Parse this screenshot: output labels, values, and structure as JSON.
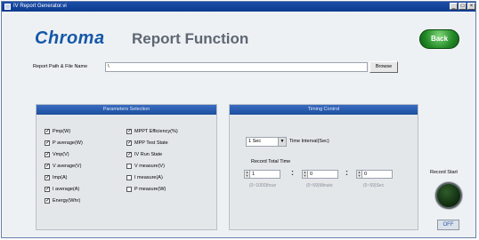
{
  "window": {
    "title": "IV Report Generator.vi",
    "controls": {
      "minimize": "_",
      "maximize": "□",
      "close": "×"
    }
  },
  "header": {
    "logo": "Chroma",
    "title": "Report Function",
    "back_label": "Back"
  },
  "report_path": {
    "label": "Report Path & File Name",
    "value": "\\",
    "browse_label": "Browse"
  },
  "parameters": {
    "title": "Parameters Selection",
    "left_column": [
      {
        "label": "Pmp(W)",
        "checked": true
      },
      {
        "label": "P average(W)",
        "checked": true
      },
      {
        "label": "Vmp(V)",
        "checked": true
      },
      {
        "label": "V average(V)",
        "checked": true
      },
      {
        "label": "Imp(A)",
        "checked": true
      },
      {
        "label": "I average(A)",
        "checked": true
      },
      {
        "label": "Energy(Whr)",
        "checked": true
      }
    ],
    "right_column": [
      {
        "label": "MPPT Efficiency(%)",
        "checked": true
      },
      {
        "label": "MPP Test State",
        "checked": true
      },
      {
        "label": "IV Run State",
        "checked": true
      },
      {
        "label": "V measure(V)",
        "checked": false
      },
      {
        "label": "I measure(A)",
        "checked": false
      },
      {
        "label": "P measure(W)",
        "checked": false
      }
    ]
  },
  "timing": {
    "title": "Timing Control",
    "interval_value": "1 Sec",
    "interval_label": "Time Interval(Sec)",
    "record_total_label": "Record Total Time",
    "hour": {
      "value": "1",
      "hint": "(0~1000)hour"
    },
    "minute": {
      "value": "0",
      "hint": "(0~59)Minute"
    },
    "second": {
      "value": "0",
      "hint": "(0~59)Sec"
    },
    "separator": ":"
  },
  "record": {
    "label": "Record Start",
    "state_label": "OFF"
  },
  "colors": {
    "title_bar": "#0b3a8f",
    "logo": "#1457a8",
    "panel_header": "#1c4f9e",
    "back_button": "#248a27",
    "led_off": "#0f2a0e"
  }
}
